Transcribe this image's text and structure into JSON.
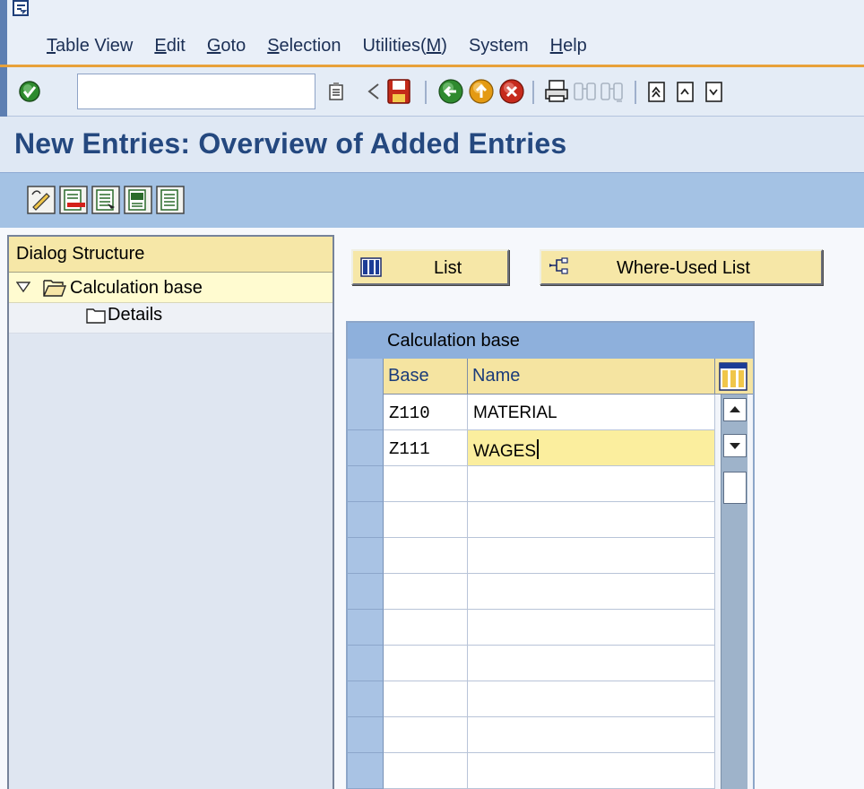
{
  "menu": {
    "items": [
      {
        "label": "Table View",
        "mnemonic": "T",
        "rest": "able View"
      },
      {
        "label": "Edit",
        "mnemonic": "E",
        "rest": "dit"
      },
      {
        "label": "Goto",
        "mnemonic": "G",
        "rest": "oto"
      },
      {
        "label": "Selection",
        "mnemonic": "S",
        "rest": "election"
      },
      {
        "label": "Utilities(M)",
        "pre": "Utilities(",
        "mnemonic": "M",
        "post": ")"
      },
      {
        "label": "System",
        "mnemonic": "",
        "rest": "System"
      },
      {
        "label": "Help",
        "mnemonic": "H",
        "rest": "elp"
      }
    ]
  },
  "system_toolbar": {
    "command_field_value": "",
    "icons": [
      "enter-icon",
      "command-history-icon",
      "back-arrow-icon",
      "save-icon",
      "back-icon",
      "exit-icon",
      "cancel-icon",
      "print-icon",
      "find-icon",
      "find-next-icon",
      "first-page-icon",
      "previous-page-icon",
      "next-page-icon"
    ]
  },
  "page": {
    "title": "New Entries: Overview of Added Entries"
  },
  "app_toolbar": {
    "icons": [
      "display-change-icon",
      "delete-icon",
      "select-all-icon",
      "select-block-icon",
      "deselect-all-icon"
    ]
  },
  "dialog_structure": {
    "header": "Dialog Structure",
    "nodes": [
      {
        "label": "Calculation base",
        "expanded": true,
        "selected": true,
        "icon": "open-folder-icon"
      },
      {
        "label": "Details",
        "expanded": false,
        "selected": false,
        "icon": "folder-icon"
      }
    ]
  },
  "buttons": {
    "list": "List",
    "where_used": "Where-Used List"
  },
  "table": {
    "title": "Calculation base",
    "columns": [
      "Base",
      "Name"
    ],
    "rows": [
      {
        "base": "Z110",
        "name": "MATERIAL"
      },
      {
        "base": "Z111",
        "name": "WAGES"
      },
      {
        "base": "",
        "name": ""
      },
      {
        "base": "",
        "name": ""
      },
      {
        "base": "",
        "name": ""
      },
      {
        "base": "",
        "name": ""
      },
      {
        "base": "",
        "name": ""
      },
      {
        "base": "",
        "name": ""
      },
      {
        "base": "",
        "name": ""
      },
      {
        "base": "",
        "name": ""
      },
      {
        "base": "",
        "name": ""
      }
    ],
    "active_row": 1
  },
  "colors": {
    "title_text": "#24487f",
    "header_yellow": "#f6e7a7",
    "table_title_blue": "#8eb0dc",
    "active_cell": "#fbee9e",
    "accent_orange": "#e8a13a"
  }
}
